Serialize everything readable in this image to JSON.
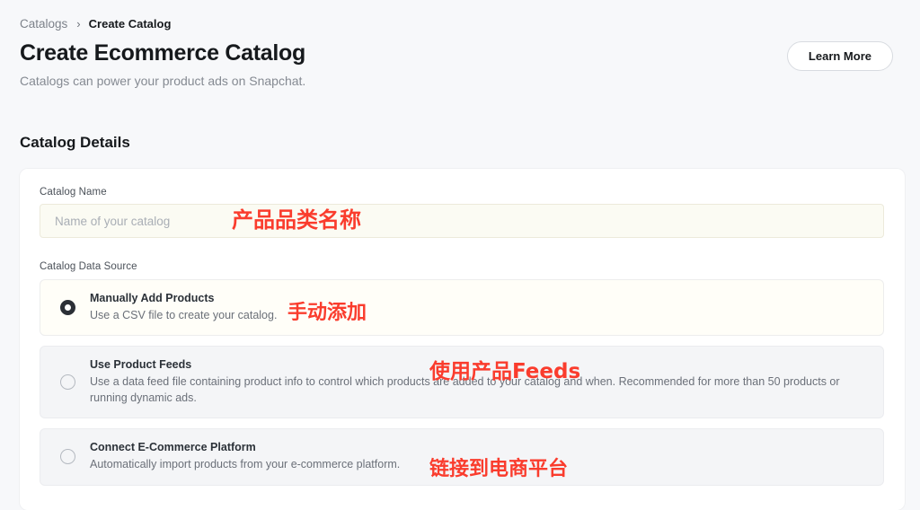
{
  "breadcrumb": {
    "root": "Catalogs",
    "separator": "›",
    "current": "Create Catalog"
  },
  "header": {
    "title": "Create Ecommerce Catalog",
    "subtitle": "Catalogs can power your product ads on Snapchat.",
    "learn_more_label": "Learn More"
  },
  "section": {
    "title": "Catalog Details"
  },
  "form": {
    "catalog_name_label": "Catalog Name",
    "catalog_name_value": "",
    "catalog_name_placeholder": "Name of your catalog",
    "data_source_label": "Catalog Data Source"
  },
  "options": [
    {
      "title": "Manually Add Products",
      "desc": "Use a CSV file to create your catalog.",
      "selected": true
    },
    {
      "title": "Use Product Feeds",
      "desc": "Use a data feed file containing product info to control which products are added to your catalog and when. Recommended for more than 50 products or running dynamic ads.",
      "selected": false
    },
    {
      "title": "Connect E-Commerce Platform",
      "desc": "Automatically import products from your e-commerce platform.",
      "selected": false
    }
  ],
  "annotations": {
    "color": "#fa3c2d",
    "catalog_name": "产品品类名称",
    "manual": "手动添加",
    "feeds": "使用产品Feeds",
    "connect": "链接到电商平台"
  }
}
